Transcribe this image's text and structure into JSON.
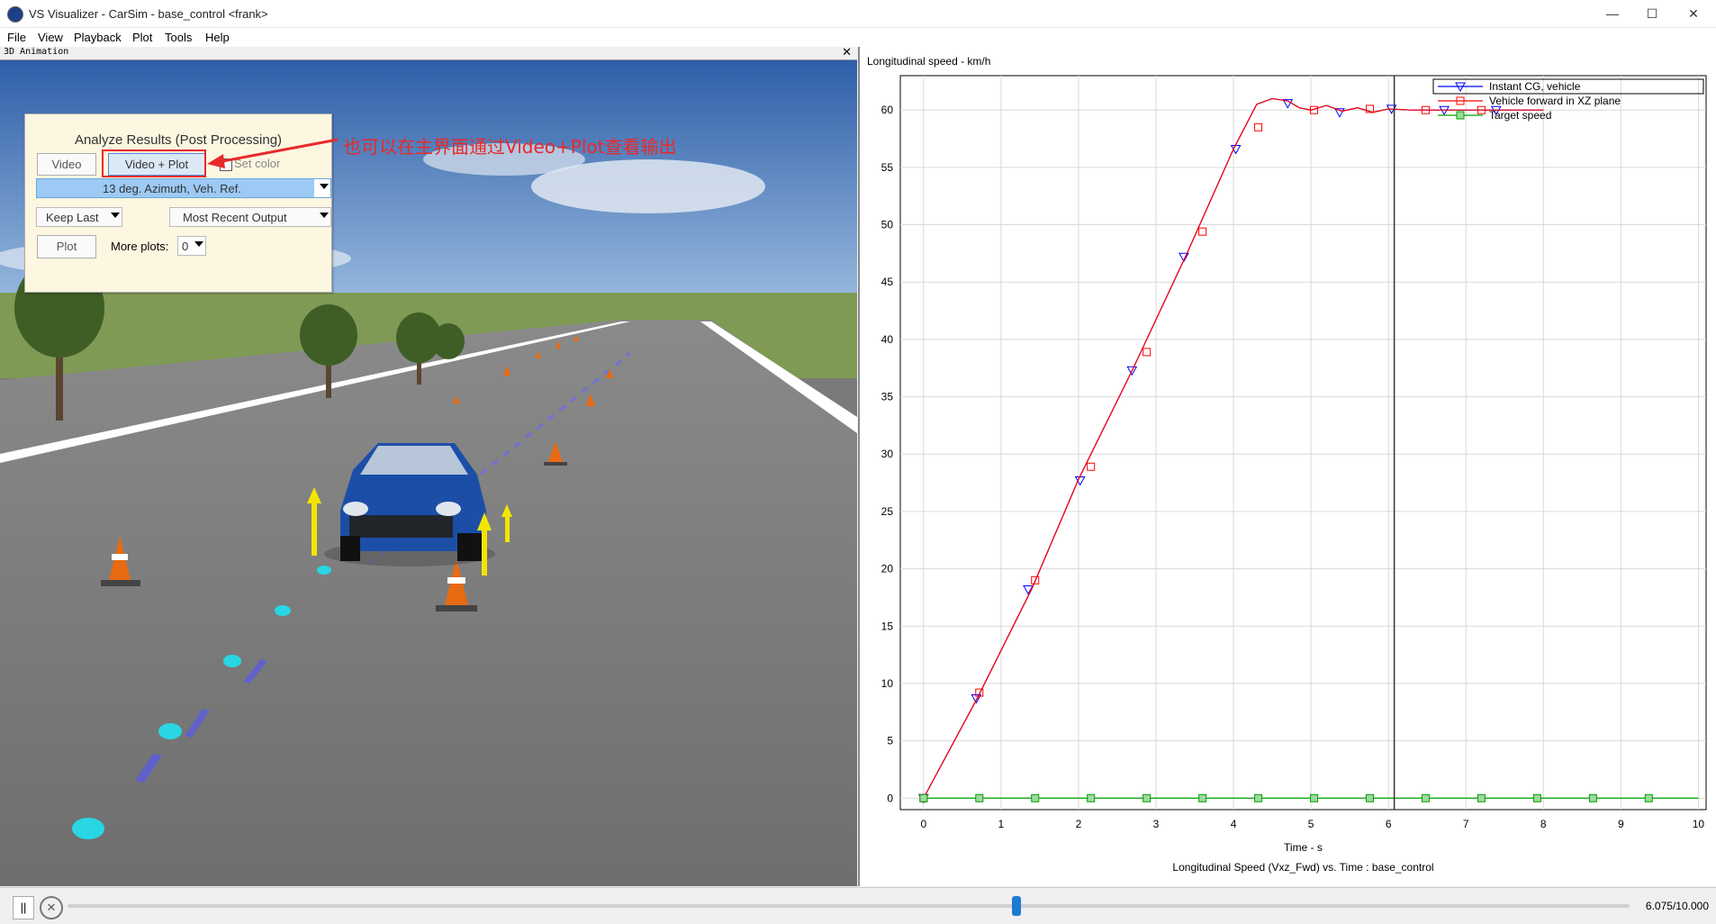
{
  "window": {
    "title": "VS Visualizer - CarSim - base_control <frank>",
    "min": "—",
    "max": "☐",
    "close": "✕"
  },
  "menu": [
    "File",
    "View",
    "Playback",
    "Plot",
    "Tools",
    "Help"
  ],
  "animation": {
    "header": "3D Animation",
    "close": "✕",
    "panel": {
      "title": "Analyze Results (Post Processing)",
      "video_button": "Video",
      "video_plot_button": "Video + Plot",
      "set_color_label": "Set color",
      "camera_view": "13 deg. Azimuth, Veh. Ref.",
      "keep_last": "Keep Last",
      "output": "Most Recent Output",
      "plot_button": "Plot",
      "more_plots_label": "More plots:",
      "more_plots_value": "0"
    },
    "annotation": "也可以在主界面通过Video+Plot查看输出"
  },
  "plot": {
    "title": "Longitudinal speed - km/h",
    "xlabel": "Time - s",
    "subtitle": "Longitudinal Speed (Vxz_Fwd) vs. Time : base_control",
    "cursor_time": 6.075
  },
  "chart_data": {
    "type": "line",
    "title": "Longitudinal speed - km/h",
    "xlabel": "Time - s",
    "ylabel": "",
    "xlim": [
      -0.3,
      10.1
    ],
    "ylim": [
      -1,
      63
    ],
    "xticks": [
      0,
      1,
      2,
      3,
      4,
      5,
      6,
      7,
      8,
      9,
      10
    ],
    "yticks": [
      0,
      5,
      10,
      15,
      20,
      25,
      30,
      35,
      40,
      45,
      50,
      55,
      60
    ],
    "grid": true,
    "legend": "top-right",
    "series": [
      {
        "name": "Instant CG, vehicle",
        "color": "#0000ff",
        "marker": "triangle-down",
        "x": [
          0,
          0.7,
          1.4,
          2.0,
          2.7,
          3.4,
          4.0,
          4.3,
          4.5,
          4.7,
          4.85,
          5.0,
          5.2,
          5.4,
          5.6,
          5.8,
          6.0,
          6.3,
          6.6,
          7.0,
          7.5,
          8.0
        ],
        "y": [
          0,
          8.8,
          18.3,
          27.8,
          37.4,
          47.5,
          56.6,
          60.5,
          61.0,
          60.8,
          60.2,
          60.0,
          60.4,
          59.9,
          60.2,
          59.8,
          60.1,
          60.0,
          60.0,
          60.0,
          60.0,
          60.0
        ],
        "markers_x": [
          0,
          0.68,
          1.35,
          2.02,
          2.69,
          3.36,
          4.03,
          4.7,
          5.37,
          6.04,
          6.72,
          7.39
        ],
        "markers_y": [
          0,
          8.7,
          18.2,
          27.7,
          37.3,
          47.2,
          56.6,
          60.6,
          59.8,
          60.1,
          60.0,
          60.0
        ]
      },
      {
        "name": "Vehicle forward in XZ plane",
        "color": "#ff0000",
        "marker": "square",
        "x": [
          0,
          0.7,
          1.4,
          2.0,
          2.7,
          3.4,
          4.0,
          4.3,
          4.5,
          4.7,
          4.85,
          5.0,
          5.2,
          5.4,
          5.6,
          5.8,
          6.0,
          6.3,
          6.6,
          7.0,
          7.5,
          8.0
        ],
        "y": [
          0,
          8.8,
          18.3,
          27.8,
          37.4,
          47.5,
          56.6,
          60.5,
          61.0,
          60.8,
          60.2,
          60.0,
          60.4,
          59.9,
          60.2,
          59.8,
          60.1,
          60.0,
          60.0,
          60.0,
          60.0,
          60.0
        ],
        "markers_x": [
          0,
          0.72,
          1.44,
          2.16,
          2.88,
          3.6,
          4.32,
          5.04,
          5.76,
          6.48,
          7.2
        ],
        "markers_y": [
          0,
          9.2,
          19.0,
          28.9,
          38.9,
          49.4,
          58.5,
          60.0,
          60.1,
          60.0,
          60.0
        ]
      },
      {
        "name": "Target speed",
        "color": "#00a000",
        "marker": "square",
        "x": [
          0,
          10
        ],
        "y": [
          0,
          0
        ],
        "markers_x": [
          0,
          0.72,
          1.44,
          2.16,
          2.88,
          3.6,
          4.32,
          5.04,
          5.76,
          6.48,
          7.2,
          7.92,
          8.64,
          9.36
        ],
        "markers_y": [
          0,
          0,
          0,
          0,
          0,
          0,
          0,
          0,
          0,
          0,
          0,
          0,
          0,
          0
        ]
      }
    ]
  },
  "playback": {
    "pause": "||",
    "position_fraction": 0.6075,
    "time_readout": "6.075/10.000"
  }
}
